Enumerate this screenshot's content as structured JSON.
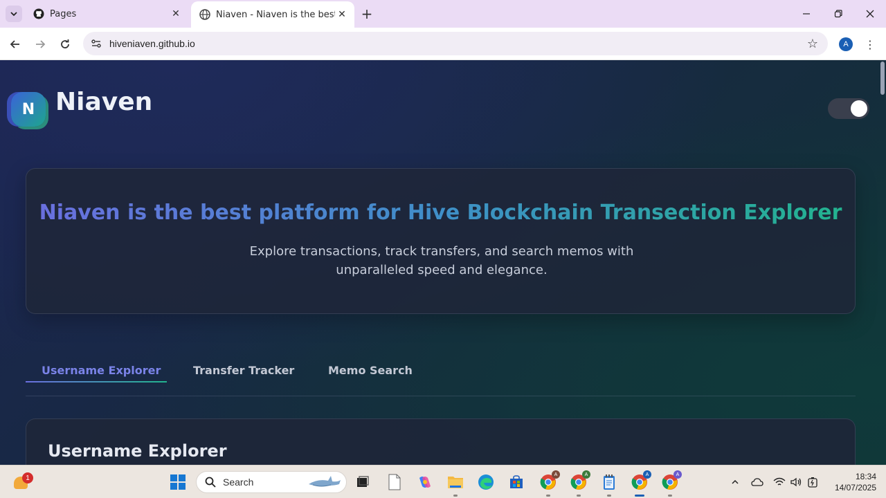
{
  "browser": {
    "tabs": [
      {
        "title": "Pages",
        "icon": "github-icon",
        "active": false
      },
      {
        "title": "Niaven - Niaven is the best plat",
        "icon": "globe-icon",
        "active": true
      }
    ],
    "url": "hiveniaven.github.io",
    "profile_initial": "A"
  },
  "site": {
    "logo_letter": "N",
    "brand": "Niaven",
    "theme_toggle_on": true,
    "hero": {
      "title": "Niaven is the best platform for Hive Blockchain Transection Explorer",
      "subtitle": "Explore transactions, track transfers, and search memos with unparalleled speed and elegance."
    },
    "tabs": [
      {
        "label": "Username Explorer",
        "active": true
      },
      {
        "label": "Transfer Tracker",
        "active": false
      },
      {
        "label": "Memo Search",
        "active": false
      }
    ],
    "section_title": "Username Explorer"
  },
  "taskbar": {
    "weather_badge": "1",
    "search_placeholder": "Search",
    "clock": {
      "time": "18:34",
      "date": "14/07/2025"
    }
  },
  "colors": {
    "accent_start": "#6b6fe0",
    "accent_end": "#22b48e",
    "page_bg": "#1b2550"
  }
}
